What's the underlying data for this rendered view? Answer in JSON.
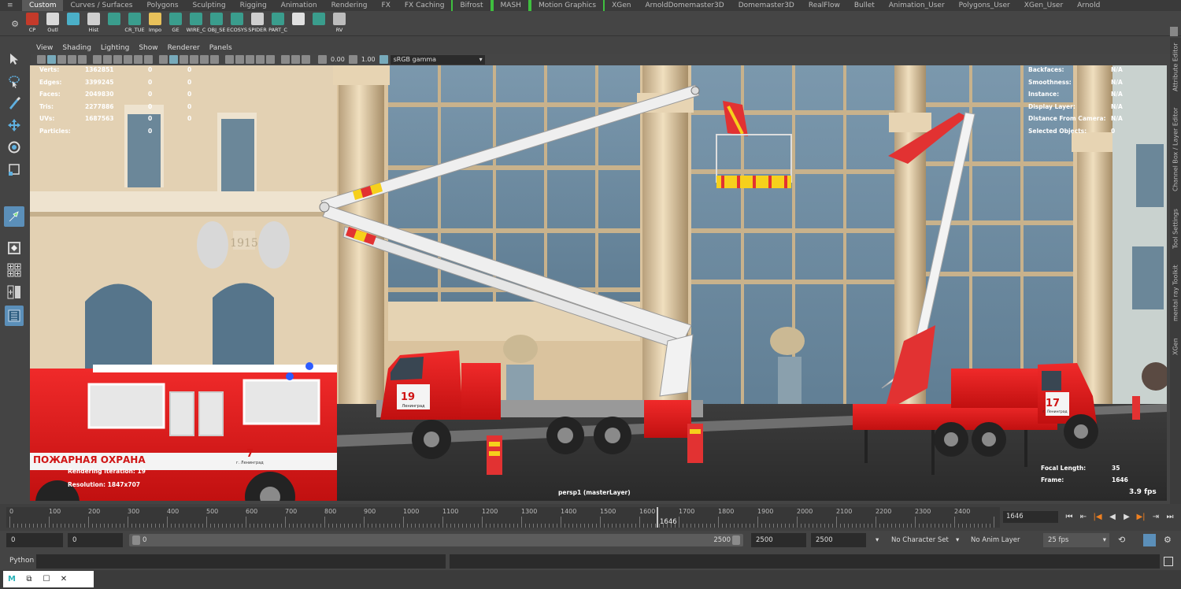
{
  "shelf": {
    "tabs": [
      {
        "label": "Custom",
        "active": true
      },
      {
        "label": "Curves / Surfaces"
      },
      {
        "label": "Polygons"
      },
      {
        "label": "Sculpting"
      },
      {
        "label": "Rigging"
      },
      {
        "label": "Animation"
      },
      {
        "label": "Rendering"
      },
      {
        "label": "FX"
      },
      {
        "label": "FX Caching"
      },
      {
        "label": "Bifrost",
        "boxed": true
      },
      {
        "label": "MASH",
        "boxed": true
      },
      {
        "label": "Motion Graphics",
        "boxed": true
      },
      {
        "label": "XGen"
      },
      {
        "label": "ArnoldDomemaster3D"
      },
      {
        "label": "Domemaster3D"
      },
      {
        "label": "RealFlow"
      },
      {
        "label": "Bullet"
      },
      {
        "label": "Animation_User"
      },
      {
        "label": "Polygons_User"
      },
      {
        "label": "XGen_User"
      },
      {
        "label": "Arnold"
      }
    ],
    "items": [
      {
        "label": "CP",
        "icon": "cp-icon",
        "color": "#c43a2a"
      },
      {
        "label": "Outl",
        "icon": "outliner-icon",
        "color": "#d8d8d8"
      },
      {
        "label": "",
        "icon": "target-icon",
        "color": "#4bb0c8"
      },
      {
        "label": "Hist",
        "icon": "history-icon",
        "color": "#cfcfcf"
      },
      {
        "label": "",
        "icon": "node-icon",
        "color": "#3a9d8d"
      },
      {
        "label": "CR_TUE",
        "icon": "cr-tube-icon",
        "color": "#3a9d8d"
      },
      {
        "label": "Impo",
        "icon": "folder-icon",
        "color": "#e8c15a"
      },
      {
        "label": "GE",
        "icon": "ge-icon",
        "color": "#3a9d8d"
      },
      {
        "label": "WIRE_C",
        "icon": "wire-icon",
        "color": "#3a9d8d"
      },
      {
        "label": "OBJ_SE",
        "icon": "obj-icon",
        "color": "#3a9d8d"
      },
      {
        "label": "ECOSYS",
        "icon": "ecosystem-icon",
        "color": "#3a9d8d"
      },
      {
        "label": "SPIDER",
        "icon": "spider-icon",
        "color": "#cfcfcf"
      },
      {
        "label": "PART_C",
        "icon": "particle-icon",
        "color": "#3a9d8d"
      },
      {
        "label": "",
        "icon": "checker-icon",
        "color": "#e0e0e0"
      },
      {
        "label": "",
        "icon": "render-icon",
        "color": "#3a9d8d"
      },
      {
        "label": "RV",
        "icon": "rv-icon",
        "color": "#bcbcbc"
      }
    ]
  },
  "viewport": {
    "menus": [
      "View",
      "Shading",
      "Lighting",
      "Show",
      "Renderer",
      "Panels"
    ],
    "exposure": "0.00",
    "gamma": "1.00",
    "colorspace": "sRGB gamma",
    "camera_label": "persp1 (masterLayer)",
    "fps_readout": "3.9 fps",
    "render_iteration": "Rendering iteration: 19",
    "resolution": "Resolution: 1847x707",
    "hud_left": [
      {
        "k": "Verts:",
        "v": "1362851",
        "c1": "0",
        "c2": "0"
      },
      {
        "k": "Edges:",
        "v": "3399245",
        "c1": "0",
        "c2": "0"
      },
      {
        "k": "Faces:",
        "v": "2049830",
        "c1": "0",
        "c2": "0"
      },
      {
        "k": "Tris:",
        "v": "2277886",
        "c1": "0",
        "c2": "0"
      },
      {
        "k": "UVs:",
        "v": "1687563",
        "c1": "0",
        "c2": "0"
      },
      {
        "k": "Particles:",
        "v": "",
        "c1": "0",
        "c2": ""
      }
    ],
    "hud_right": [
      {
        "k": "Backfaces:",
        "v": "N/A"
      },
      {
        "k": "Smoothness:",
        "v": "N/A"
      },
      {
        "k": "Instance:",
        "v": "N/A"
      },
      {
        "k": "Display Layer:",
        "v": "N/A"
      },
      {
        "k": "Distance From Camera:",
        "v": "N/A"
      },
      {
        "k": "Selected Objects:",
        "v": "0"
      }
    ],
    "focal_label": "Focal Length:",
    "focal_value": "35",
    "frame_label": "Frame:",
    "frame_value": "1646",
    "scene_text": {
      "year": "1915",
      "bus_text": "ПОЖАРНАЯ ОХРАНА",
      "bus_number": "7",
      "bus_city": "г. Ленинград",
      "truck1_number": "19",
      "truck1_city": "Ленинград",
      "truck2_number": "17",
      "truck2_city": "г. Ленинград"
    }
  },
  "side_tabs": [
    "Attribute Editor",
    "Channel Box / Layer Editor",
    "Tool Settings",
    "mental ray Toolkit",
    "XGen"
  ],
  "timeline": {
    "ticks": [
      "0",
      "100",
      "200",
      "300",
      "400",
      "500",
      "600",
      "700",
      "800",
      "900",
      "1000",
      "1100",
      "1200",
      "1300",
      "1400",
      "1500",
      "1600",
      "1700",
      "1800",
      "1900",
      "2000",
      "2100",
      "2200",
      "2300",
      "2400"
    ],
    "current": "1646",
    "current_frame_field": "1646",
    "max": 2500
  },
  "range": {
    "start": "0",
    "anim_start": "0",
    "slider_start": "0",
    "slider_end": "2500",
    "anim_end": "2500",
    "end": "2500",
    "character_set": "No Character Set",
    "anim_layer": "No Anim Layer",
    "fps": "25 fps"
  },
  "command_line": {
    "label": "Python"
  },
  "colors": {
    "accent": "#5b8fb9",
    "truck_red": "#e01b1b",
    "building": "#ddc7a3",
    "glass": "#6f8ea4"
  }
}
